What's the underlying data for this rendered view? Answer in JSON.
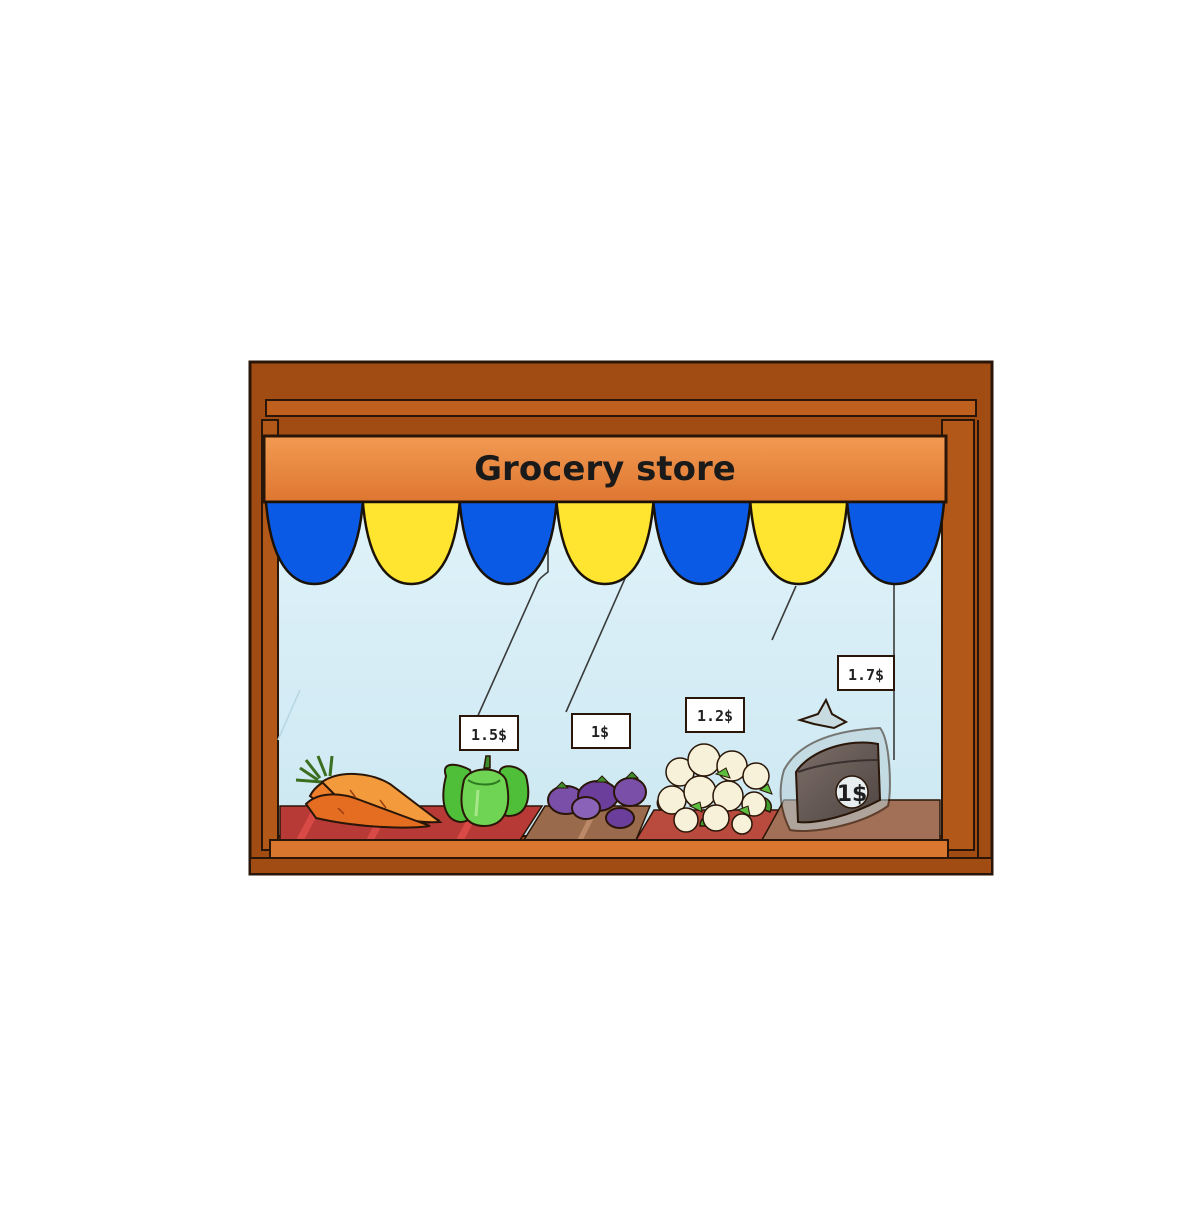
{
  "store": {
    "sign_text": "Grocery store"
  },
  "awning": {
    "scallops": [
      "blue",
      "yellow",
      "blue",
      "yellow",
      "blue",
      "yellow",
      "blue"
    ]
  },
  "products": [
    {
      "name": "carrots",
      "price": ""
    },
    {
      "name": "green peppers",
      "price": "1.5$"
    },
    {
      "name": "eggplants",
      "price": "1$"
    },
    {
      "name": "cauliflower",
      "price": "1.2$"
    },
    {
      "name": "bread loaf in bag",
      "price": "1.7$",
      "bag_label": "1$"
    }
  ],
  "colors": {
    "wood_dark": "#9c4a12",
    "wood_mid": "#b5561a",
    "sign_orange": "#ec8a3e",
    "awning_blue": "#0a5ae6",
    "awning_yellow": "#ffe430",
    "glass": "#d6eef6",
    "shelf_red": "#b83a36",
    "shelf_wood": "#9a6a4c"
  }
}
